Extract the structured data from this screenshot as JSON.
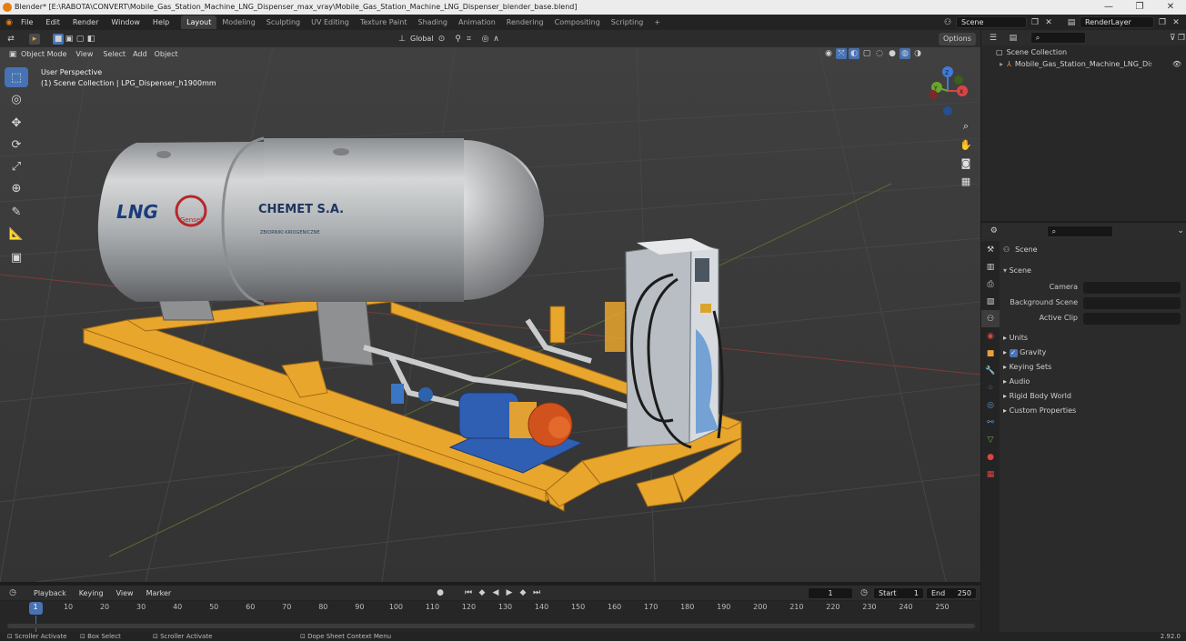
{
  "window": {
    "title": "Blender* [E:\\RABOTA\\CONVERT\\Mobile_Gas_Station_Machine_LNG_Dispenser_max_vray\\Mobile_Gas_Station_Machine_LNG_Dispenser_blender_base.blend]",
    "controls": [
      "—",
      "❐",
      "✕"
    ]
  },
  "menubar": {
    "items": [
      "File",
      "Edit",
      "Render",
      "Window",
      "Help"
    ],
    "workspaces": [
      "Layout",
      "Modeling",
      "Sculpting",
      "UV Editing",
      "Texture Paint",
      "Shading",
      "Animation",
      "Rendering",
      "Compositing",
      "Scripting"
    ],
    "active_workspace": "Layout",
    "add_tab": "+",
    "scene_field": "Scene",
    "view_layer_field": "RenderLayer"
  },
  "viewport_header": {
    "mode": "Object Mode",
    "menus": [
      "View",
      "Select",
      "Add",
      "Object"
    ],
    "transform_orientation": "Global",
    "options_button": "Options"
  },
  "viewport": {
    "perspective_label": "User Perspective",
    "collection_label": "(1) Scene Collection | LPG_Dispenser_h1900mm",
    "model_texts": {
      "tank_left": "LNG",
      "tank_company": "CHEMET S.A.",
      "tank_sub": "ZBIORNIKI KRIOGENICZNE",
      "logo": "Gensel"
    },
    "gizmo_axes": [
      "X",
      "Y",
      "Z"
    ]
  },
  "toolbar": {
    "tools": [
      "select-box",
      "cursor",
      "move",
      "rotate",
      "scale",
      "transform",
      "annotate",
      "measure",
      "add-cube"
    ]
  },
  "outliner": {
    "root": "Scene Collection",
    "items": [
      {
        "label": "Mobile_Gas_Station_Machine_LNG_Dispenser",
        "visible": true
      }
    ]
  },
  "properties": {
    "context_title": "Scene",
    "panel_title": "Scene",
    "fields": [
      {
        "label": "Camera",
        "value": ""
      },
      {
        "label": "Background Scene",
        "value": ""
      },
      {
        "label": "Active Clip",
        "value": ""
      }
    ],
    "collapsed_panels": [
      "Units",
      "Gravity",
      "Keying Sets",
      "Audio",
      "Rigid Body World",
      "Custom Properties"
    ],
    "gravity_checked": true
  },
  "timeline": {
    "menus": [
      "Playback",
      "Keying",
      "View",
      "Marker"
    ],
    "current_frame": "1",
    "start_label": "Start",
    "start_value": "1",
    "end_label": "End",
    "end_value": "250",
    "ruler_ticks": [
      "1",
      "10",
      "20",
      "30",
      "40",
      "50",
      "60",
      "70",
      "80",
      "90",
      "100",
      "110",
      "120",
      "130",
      "140",
      "150",
      "160",
      "170",
      "180",
      "190",
      "200",
      "210",
      "220",
      "230",
      "240",
      "250"
    ]
  },
  "statusbar": {
    "items": [
      "Scroller Activate",
      "Box Select",
      "Scroller Activate",
      "Dope Sheet Context Menu"
    ],
    "version": "2.92.0"
  },
  "colors": {
    "accent": "#4772b3",
    "frame_yellow": "#e9a62d",
    "tank_silver": "#b7b9ba",
    "pump_blue": "#2f5fb3",
    "motor_orange": "#d2521d",
    "blender_orange": "#e87d0d"
  }
}
